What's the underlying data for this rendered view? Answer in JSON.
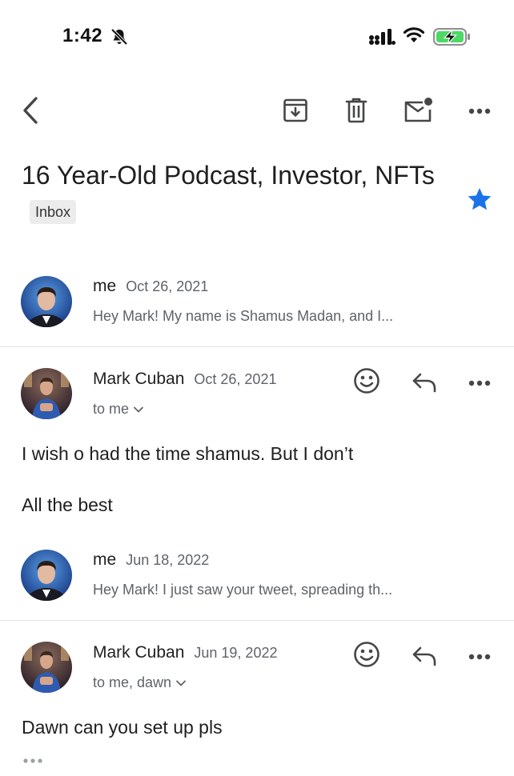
{
  "status_bar": {
    "time": "1:42",
    "icons": [
      "bell-slash-icon",
      "signal-icon",
      "wifi-icon",
      "battery-charging-icon"
    ],
    "battery_color": "#4cd964"
  },
  "toolbar": {
    "icons": [
      "back-arrow-icon",
      "archive-icon",
      "trash-icon",
      "mark-unread-icon",
      "more-options-icon"
    ]
  },
  "thread": {
    "subject": "16 Year-Old Podcast, Investor, NFTs",
    "label": "Inbox",
    "starred": true,
    "star_color": "#1a73e8"
  },
  "messages": [
    {
      "sender": "me",
      "date": "Oct 26, 2021",
      "snippet": "Hey Mark! My name is Shamus Madan, and I..."
    },
    {
      "sender": "Mark Cuban",
      "date": "Oct 26, 2021",
      "recipients": "to me",
      "body": [
        "I wish o had the time shamus. But I don’t",
        "All the best"
      ],
      "actions": [
        "emoji-reaction-icon",
        "reply-icon",
        "more-options-icon"
      ]
    },
    {
      "sender": "me",
      "date": "Jun 18, 2022",
      "snippet": "Hey Mark! I just saw your tweet, spreading th..."
    },
    {
      "sender": "Mark Cuban",
      "date": "Jun 19, 2022",
      "recipients": "to me, dawn",
      "body": [
        "Dawn can you set up pls"
      ],
      "actions": [
        "emoji-reaction-icon",
        "reply-icon",
        "more-options-icon"
      ]
    }
  ],
  "colors": {
    "text_primary": "#1f1f1f",
    "text_secondary": "#5f6368",
    "icon_gray": "#444746"
  }
}
